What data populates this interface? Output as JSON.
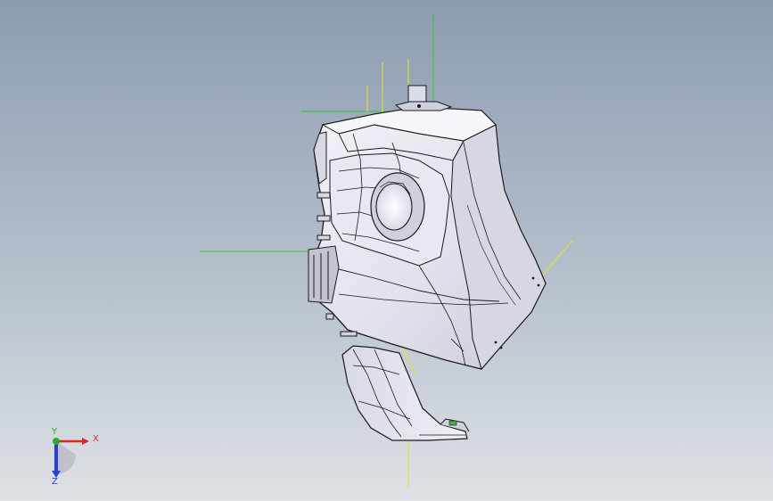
{
  "viewport": {
    "background_top": "#8c9cb0",
    "background_bottom": "#dfe2e6"
  },
  "model": {
    "body_color": "#e3e3ee",
    "shade_color": "#c9c9d9",
    "edge_color": "#1a1a1a",
    "reference_green": "#2ecc2e",
    "reference_yellow": "#e6e619"
  },
  "triad": {
    "x_label": "X",
    "y_label": "Y",
    "z_label": "Z",
    "x_color": "#d62828",
    "y_color": "#2eaa2e",
    "z_color": "#2b3fd6"
  }
}
